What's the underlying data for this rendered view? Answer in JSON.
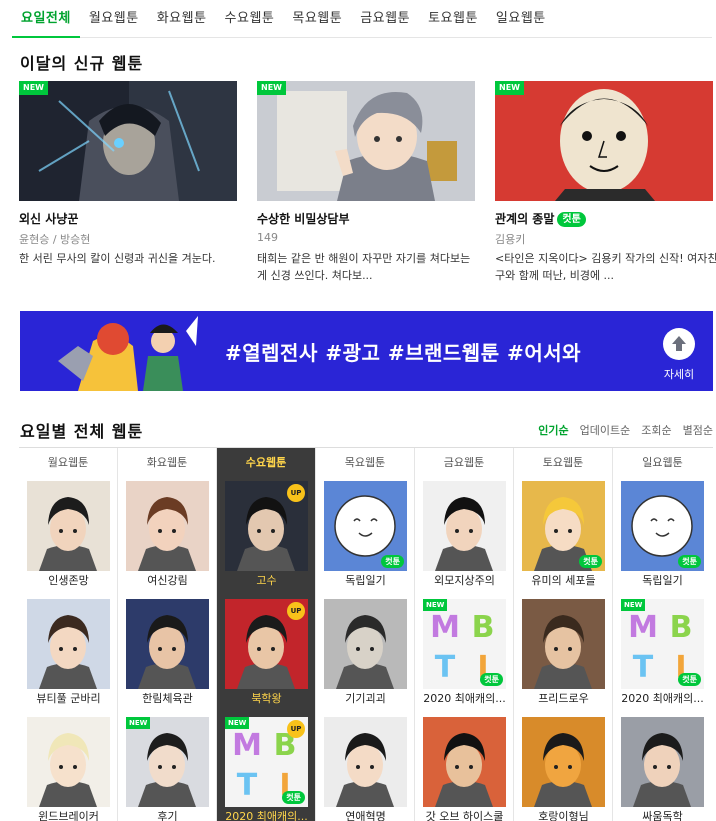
{
  "tabs": [
    "요일전체",
    "월요웹툰",
    "화요웹툰",
    "수요웹툰",
    "목요웹툰",
    "금요웹툰",
    "토요웹툰",
    "일요웹툰"
  ],
  "new_section": {
    "title": "이달의 신규 웹툰",
    "badge": "NEW",
    "cut_badge": "컷툰",
    "cards": [
      {
        "title": "외신 사냥꾼",
        "author": "윤현승 / 방승현",
        "desc": "한 서린 무사의 칼이 신령과 귀신을 겨눈다."
      },
      {
        "title": "수상한 비밀상담부",
        "author": "149",
        "desc": "태희는 같은 반 해원이 자꾸만 자기를 쳐다보는 게 신경 쓰인다. 쳐다보..."
      },
      {
        "title": "관계의 종말",
        "author": "김용키",
        "desc": "<타인은 지옥이다> 김용키 작가의 신작! 여자친구와 함께 떠난, 비경에 ..."
      }
    ]
  },
  "banner": {
    "text": "#열렙전사 #광고 #브랜드웹툰 #어서와",
    "button_label": "자세히"
  },
  "weekday_section": {
    "title": "요일별 전체 웹툰",
    "sort": [
      "인기순",
      "업데이트순",
      "조회순",
      "별점순"
    ],
    "columns": [
      {
        "day": "월요웹툰",
        "items": [
          "인생존망",
          "뷰티풀 군바리",
          "윈드브레이커"
        ]
      },
      {
        "day": "화요웹툰",
        "items": [
          "여신강림",
          "한림체육관",
          "후기"
        ]
      },
      {
        "day": "수요웹툰",
        "items": [
          "고수",
          "북학왕",
          "2020 최애캐의..."
        ]
      },
      {
        "day": "목요웹툰",
        "items": [
          "독립일기",
          "기기괴괴",
          "연애혁명"
        ]
      },
      {
        "day": "금요웹툰",
        "items": [
          "외모지상주의",
          "2020 최애캐의...",
          "갓 오브 하이스쿨"
        ]
      },
      {
        "day": "토요웹툰",
        "items": [
          "유미의 세포들",
          "프리드로우",
          "호랑이형님"
        ]
      },
      {
        "day": "일요웹툰",
        "items": [
          "독립일기",
          "2020 최애캐의...",
          "싸움독학"
        ]
      }
    ],
    "badges": {
      "up": "UP",
      "new": "NEW",
      "cut": "컷툰"
    },
    "mbti_letters": [
      "M",
      "B",
      "T",
      "I"
    ]
  },
  "colors": {
    "accent": "#00c73c",
    "active_col_bg": "#3b3b3b",
    "active_col_text": "#ffd54b",
    "banner_bg": "#2a25d6"
  }
}
